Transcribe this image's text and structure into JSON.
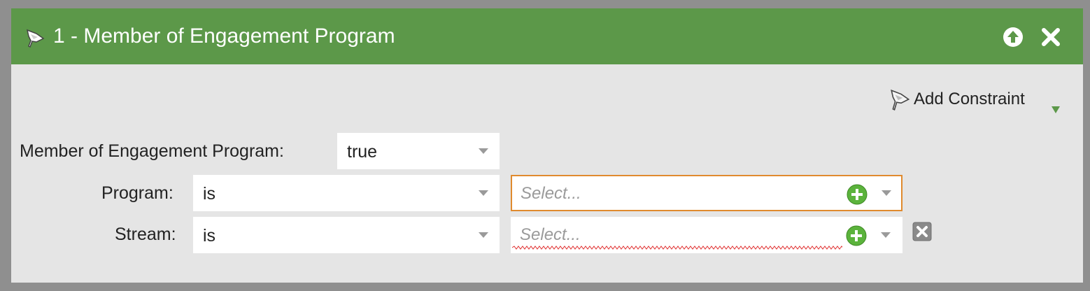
{
  "header": {
    "title": "1 - Member of Engagement Program",
    "icon": "funnel-icon",
    "accent_color": "#5c9849",
    "actions": [
      {
        "name": "move-up",
        "icon": "arrow-up-circle-icon"
      },
      {
        "name": "close",
        "icon": "close-icon"
      }
    ]
  },
  "toolbar": {
    "add_constraint_label": "Add Constraint"
  },
  "filter": {
    "main_label": "Member of Engagement Program:",
    "main_value": "true",
    "rows": [
      {
        "label": "Program:",
        "operator": "is",
        "placeholder": "Select...",
        "focused": true
      },
      {
        "label": "Stream:",
        "operator": "is",
        "placeholder": "Select...",
        "focused": false
      }
    ]
  }
}
